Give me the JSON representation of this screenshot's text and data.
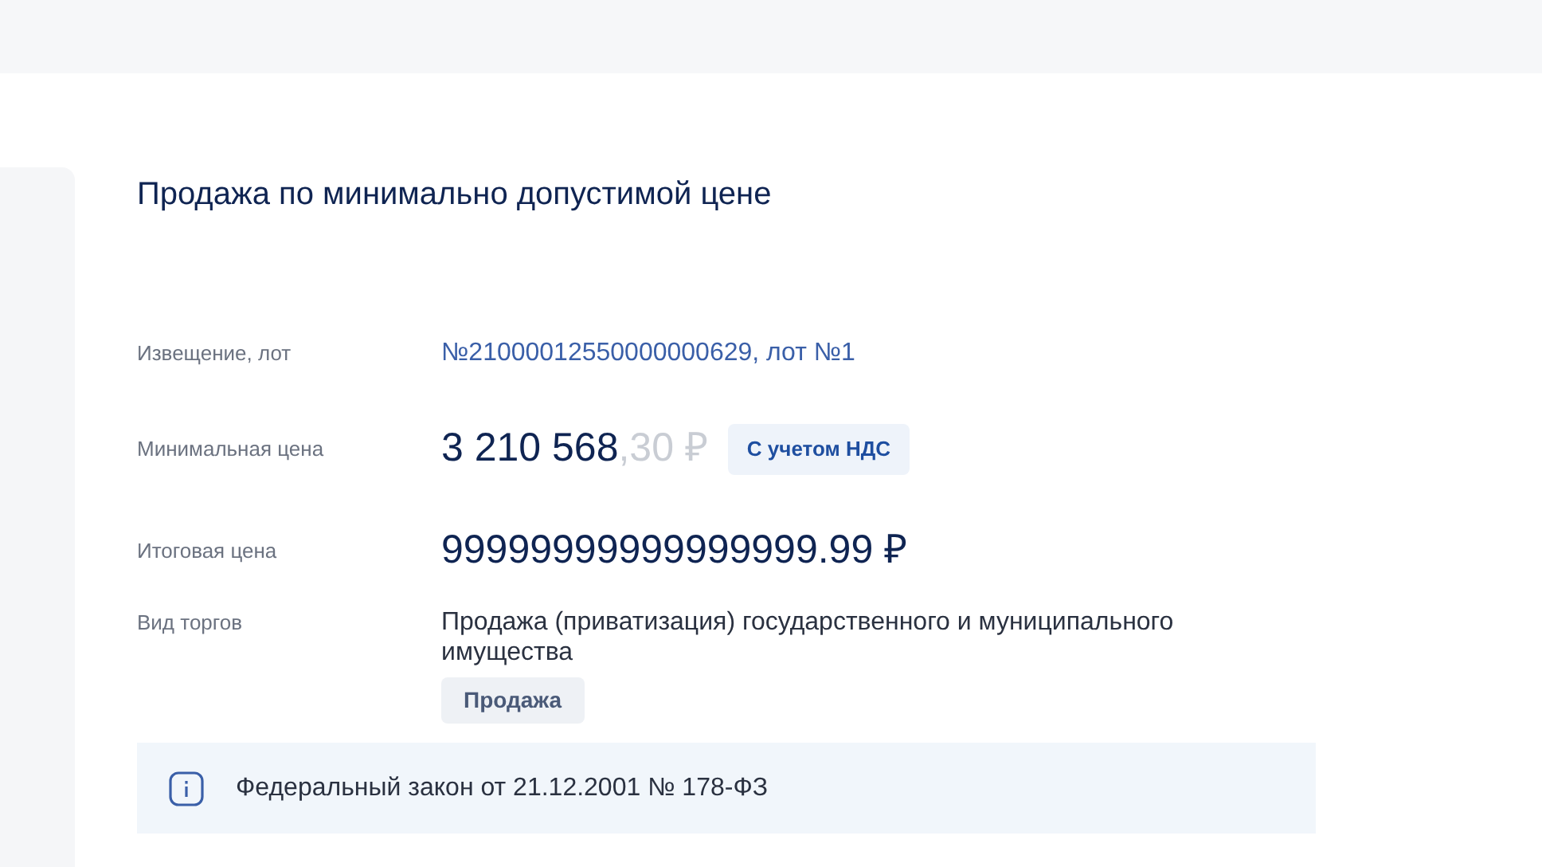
{
  "title": "Продажа по минимально допустимой цене",
  "rows": [
    {
      "kind": "link",
      "label": "Извещение, лот",
      "value": "№21000012550000000629, лот №1"
    },
    {
      "kind": "price",
      "label": "Минимальная цена",
      "value": "3 210 568",
      "fraction": ",30 ₽",
      "badge": "С учетом НДС"
    },
    {
      "kind": "total",
      "label": "Итоговая цена",
      "value": "99999999999999999.99 ₽"
    },
    {
      "kind": "text",
      "label": "Вид торгов",
      "value": "Продажа (приватизация) государственного и муниципального имущества",
      "tag": "Продажа"
    }
  ],
  "notice": {
    "text": "Федеральный закон от 21.12.2001 № 178-ФЗ"
  }
}
